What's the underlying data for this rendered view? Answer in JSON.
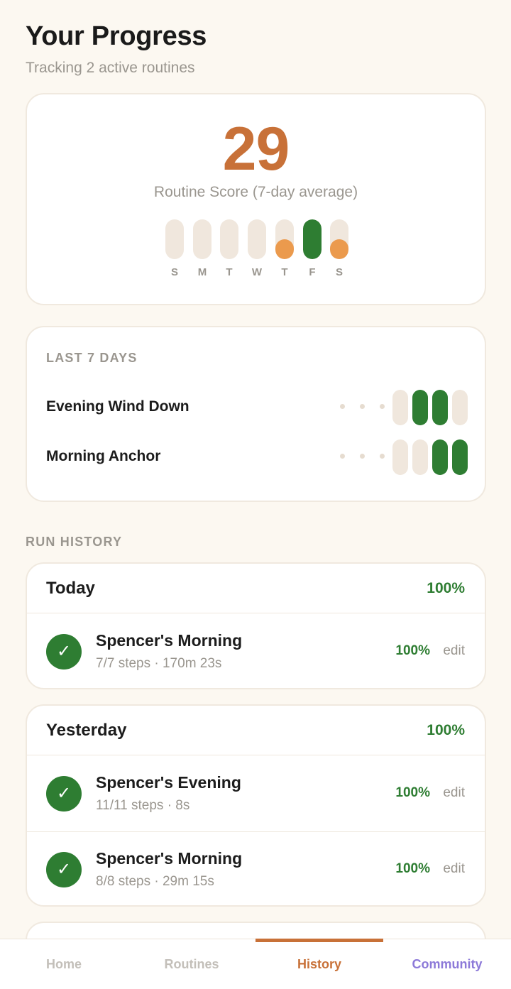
{
  "header": {
    "title": "Your Progress",
    "subtitle": "Tracking 2 active routines"
  },
  "score": {
    "value": "29",
    "label": "Routine Score (7-day average)",
    "days": [
      {
        "label": "S",
        "fill": 0,
        "color": ""
      },
      {
        "label": "M",
        "fill": 0,
        "color": ""
      },
      {
        "label": "T",
        "fill": 0,
        "color": ""
      },
      {
        "label": "W",
        "fill": 0,
        "color": ""
      },
      {
        "label": "T",
        "fill": 0.5,
        "color": "#eb9a4d"
      },
      {
        "label": "F",
        "fill": 1.0,
        "color": "#2e7d32"
      },
      {
        "label": "S",
        "fill": 0.5,
        "color": "#eb9a4d"
      }
    ]
  },
  "last7": {
    "label": "LAST 7 DAYS",
    "routines": [
      {
        "name": "Evening Wind Down",
        "days": [
          false,
          true,
          true,
          false
        ]
      },
      {
        "name": "Morning Anchor",
        "days": [
          false,
          false,
          true,
          true
        ]
      }
    ]
  },
  "history": {
    "label": "RUN HISTORY",
    "groups": [
      {
        "day": "Today",
        "pct": "100%",
        "runs": [
          {
            "name": "Spencer's Morning",
            "meta": "7/7 steps · 170m 23s",
            "pct": "100%",
            "edit": "edit"
          }
        ]
      },
      {
        "day": "Yesterday",
        "pct": "100%",
        "runs": [
          {
            "name": "Spencer's Evening",
            "meta": "11/11 steps · 8s",
            "pct": "100%",
            "edit": "edit"
          },
          {
            "name": "Spencer's Morning",
            "meta": "8/8 steps · 29m 15s",
            "pct": "100%",
            "edit": "edit"
          }
        ]
      }
    ]
  },
  "icons": {
    "check": "check-icon",
    "check_glyph": "✓"
  },
  "colors": {
    "accent": "#c87138",
    "success": "#2e7d32",
    "partial": "#eb9a4d",
    "track": "#f0e7dd",
    "community": "#8c79d8"
  },
  "nav": {
    "home": "Home",
    "routines": "Routines",
    "history": "History",
    "community": "Community"
  }
}
